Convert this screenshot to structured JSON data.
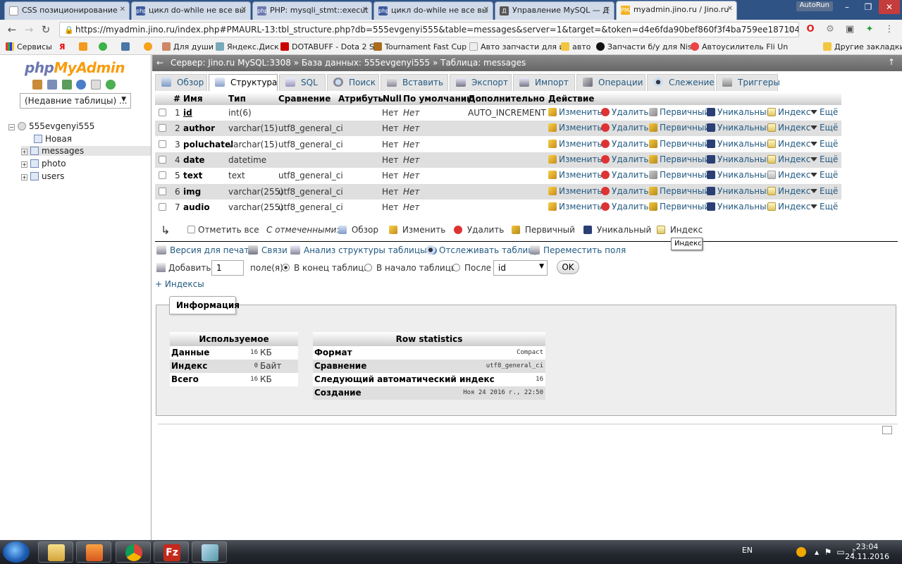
{
  "browser": {
    "tabs": [
      {
        "title": "CSS позиционирование",
        "fav": "css-favicon"
      },
      {
        "title": "цикл do-while не все вы",
        "fav": "php-favicon"
      },
      {
        "title": "PHP: mysqli_stmt::execut",
        "fav": "php-favicon"
      },
      {
        "title": "цикл do-while не все вы",
        "fav": "php-favicon"
      },
      {
        "title": "Управление MySQL — Д",
        "fav": "jino-favicon"
      },
      {
        "title": "myadmin.jino.ru / Jino.ru",
        "fav": "pma-favicon"
      }
    ],
    "autorun": "AutoRun",
    "url": "https://myadmin.jino.ru/index.php#PMAURL-13:tbl_structure.php?db=555evgenyi555&table=messages&server=1&target=&token=d4e6fda90bef860f3f4ba759ee187104",
    "bookmarks": [
      "Сервисы",
      "Я",
      "",
      "",
      "",
      "",
      "Для души",
      "Яндекс.Диск",
      "DOTABUFF - Dota 2 S",
      "Tournament Fast Cup",
      "Авто запчасти для ин",
      "авто",
      "Запчасти б/у для Nis",
      "Автоусилитель Fli Un",
      "Другие закладки"
    ]
  },
  "nav": {
    "logo_php": "php",
    "logo_my": "MyAdmin",
    "recent_tables": "(Недавние таблицы) ...",
    "tree": {
      "db": "555evgenyi555",
      "new": "Новая",
      "tables": [
        "messages",
        "photo",
        "users"
      ]
    }
  },
  "main": {
    "breadcrumb": {
      "server": "Сервер: Jino.ru MySQL:3308",
      "sep1": "»",
      "database": "База данных: 555evgenyi555",
      "sep2": "»",
      "table": "Таблица: messages"
    },
    "tabs": [
      "Обзор",
      "Структура",
      "SQL",
      "Поиск",
      "Вставить",
      "Экспорт",
      "Импорт",
      "Операции",
      "Слежение",
      "Триггеры"
    ],
    "columns_header": {
      "num": "#",
      "name": "Имя",
      "type": "Тип",
      "collation": "Сравнение",
      "attributes": "Атрибуты",
      "null": "Null",
      "default": "По умолчанию",
      "extra": "Дополнительно",
      "action": "Действие"
    },
    "rows": [
      {
        "n": "1",
        "name": "id",
        "type": "int(6)",
        "collation": "",
        "null": "Нет",
        "default": "Нет",
        "extra": "AUTO_INCREMENT"
      },
      {
        "n": "2",
        "name": "author",
        "type": "varchar(15)",
        "collation": "utf8_general_ci",
        "null": "Нет",
        "default": "Нет",
        "extra": ""
      },
      {
        "n": "3",
        "name": "poluchatel",
        "type": "varchar(15)",
        "collation": "utf8_general_ci",
        "null": "Нет",
        "default": "Нет",
        "extra": ""
      },
      {
        "n": "4",
        "name": "date",
        "type": "datetime",
        "collation": "",
        "null": "Нет",
        "default": "Нет",
        "extra": ""
      },
      {
        "n": "5",
        "name": "text",
        "type": "text",
        "collation": "utf8_general_ci",
        "null": "Нет",
        "default": "Нет",
        "extra": ""
      },
      {
        "n": "6",
        "name": "img",
        "type": "varchar(255)",
        "collation": "utf8_general_ci",
        "null": "Нет",
        "default": "Нет",
        "extra": ""
      },
      {
        "n": "7",
        "name": "audio",
        "type": "varchar(255)",
        "collation": "utf8_general_ci",
        "null": "Нет",
        "default": "Нет",
        "extra": ""
      }
    ],
    "actions": {
      "edit": "Изменить",
      "delete": "Удалить",
      "primary": "Первичный",
      "unique": "Уникальный",
      "index": "Индекс",
      "more": "Ещё"
    },
    "with_selected": {
      "check_all": "Отметить все",
      "label": "С отмеченными:",
      "browse": "Обзор",
      "edit": "Изменить",
      "delete": "Удалить",
      "primary": "Первичный",
      "unique": "Уникальный",
      "index": "Индекс"
    },
    "tooltip": "Индекс",
    "links": {
      "print": "Версия для печати",
      "relations": "Связи",
      "analyze": "Анализ структуры таблицы",
      "track": "Отслеживать таблицу",
      "move": "Переместить поля"
    },
    "add": {
      "label": "Добавить",
      "count": "1",
      "fields": "поле(я)",
      "at_end": "В конец таблицы",
      "at_begin": "В начало таблицы",
      "after": "После",
      "after_col": "id",
      "ok": "OK"
    },
    "indexes_link": "+ Индексы",
    "info": {
      "legend": "Информация",
      "space": {
        "title": "Используемое пространство",
        "rows": [
          {
            "k": "Данные",
            "v": "16",
            "u": "КБ"
          },
          {
            "k": "Индекс",
            "v": "0",
            "u": "Байт"
          },
          {
            "k": "Всего",
            "v": "16",
            "u": "КБ"
          }
        ]
      },
      "stats": {
        "title": "Row statistics",
        "rows": [
          {
            "k": "Формат",
            "v": "Compact"
          },
          {
            "k": "Сравнение",
            "v": "utf8_general_ci"
          },
          {
            "k": "Следующий автоматический индекс",
            "v": "16"
          },
          {
            "k": "Создание",
            "v": "Ноя 24 2016 г., 22:50"
          }
        ]
      }
    }
  },
  "taskbar": {
    "lang": "EN",
    "time": "23:04",
    "date": "24.11.2016"
  }
}
